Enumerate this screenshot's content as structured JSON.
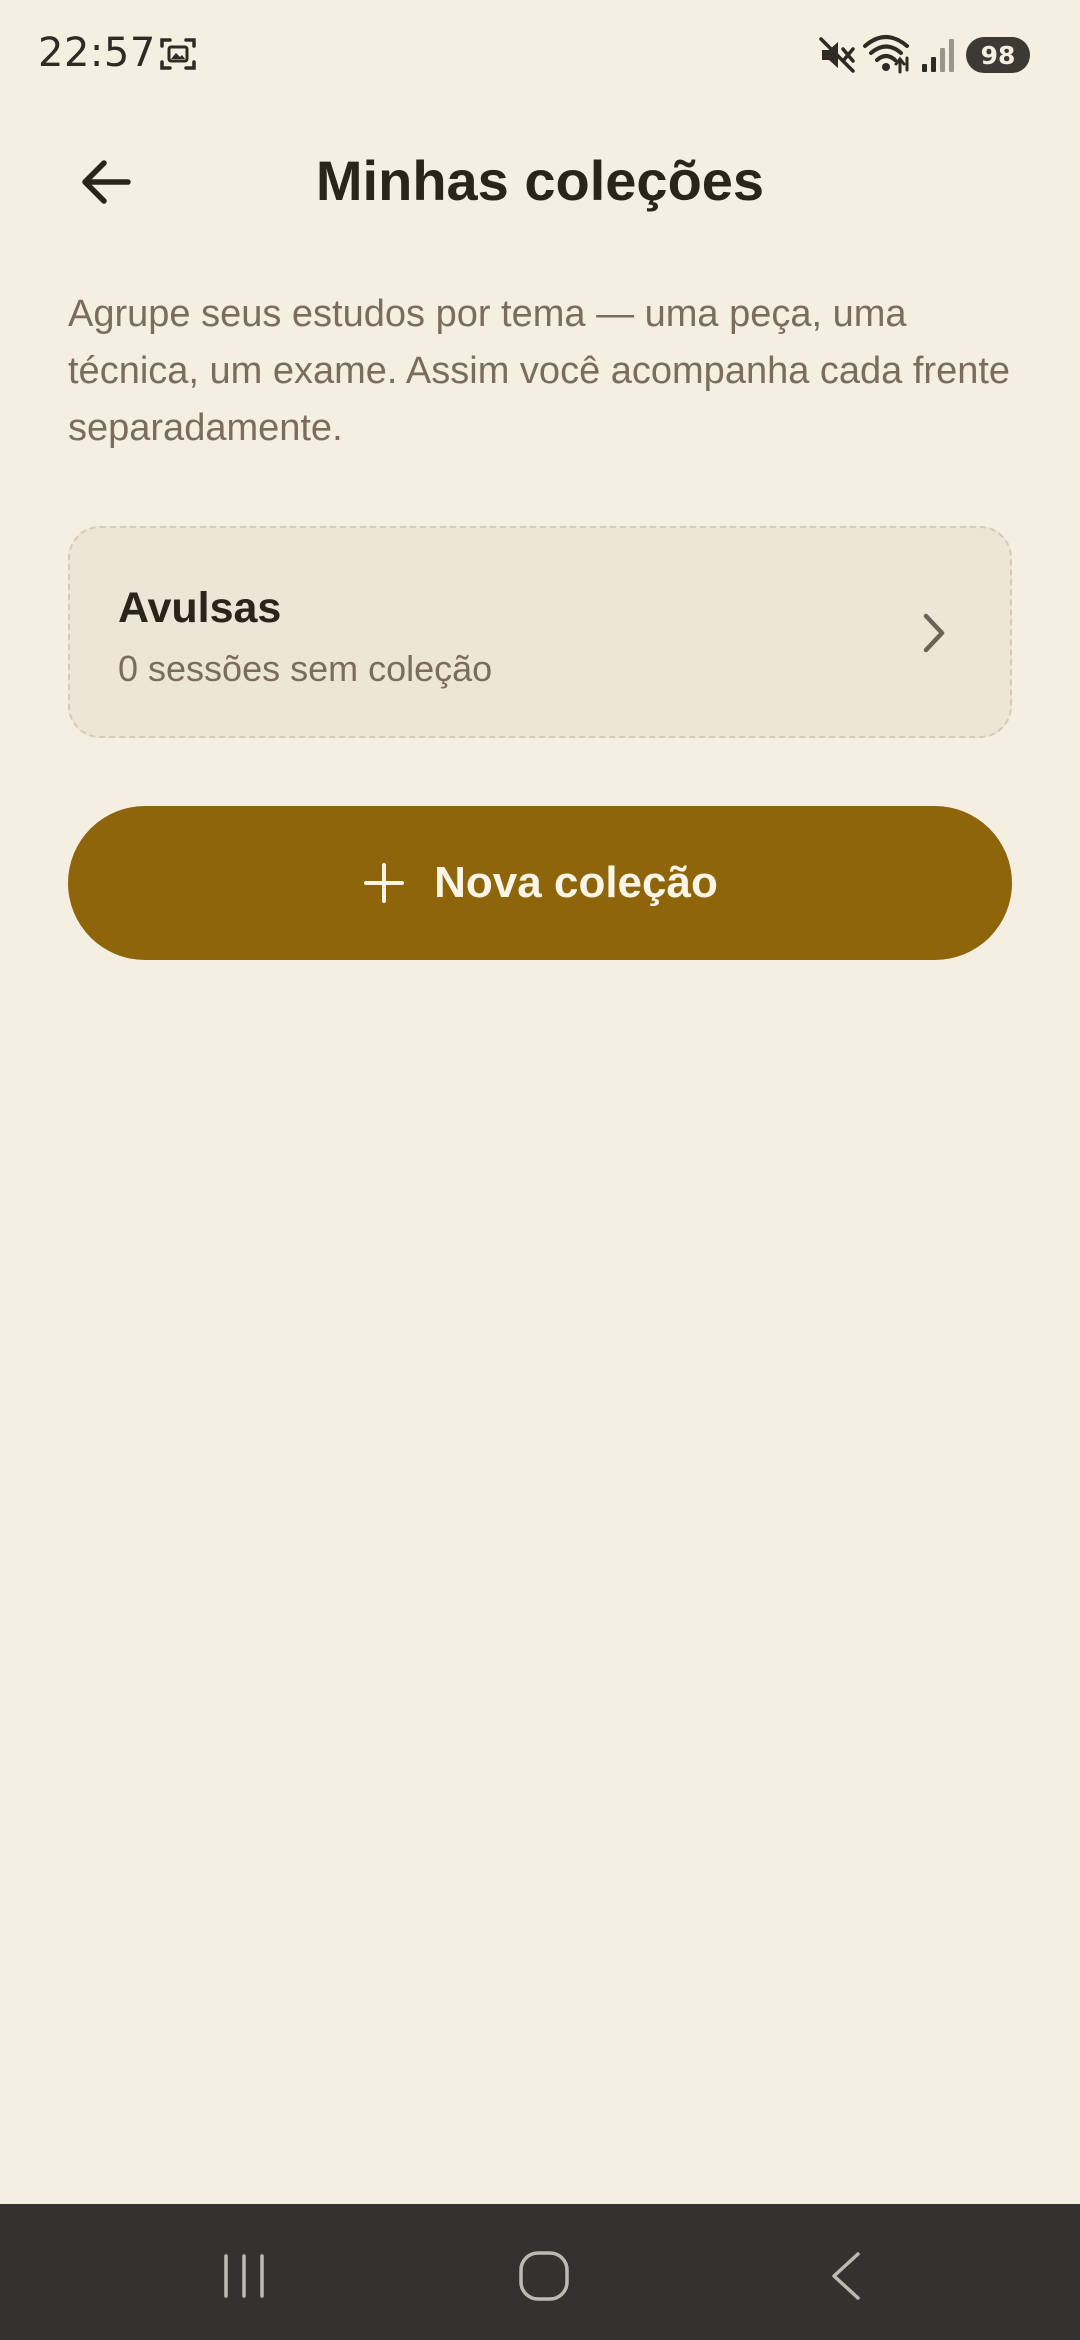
{
  "status_bar": {
    "time": "22:57",
    "battery": "98",
    "icons": [
      "screenshot-icon",
      "mute-icon",
      "wifi-icon",
      "signal-icon"
    ]
  },
  "header": {
    "title": "Minhas coleções",
    "back_icon": "arrow-left-icon"
  },
  "intro": {
    "description": "Agrupe seus estudos por tema — uma peça, uma técnica, um exame. Assim você acompanha cada frente separadamente."
  },
  "collections": [
    {
      "title": "Avulsas",
      "subtitle": "0 sessões sem coleção",
      "icon": "chevron-right-icon"
    }
  ],
  "actions": {
    "new_collection_label": "Nova coleção",
    "new_collection_icon": "plus-icon"
  },
  "nav_bar": {
    "icons": [
      "recents-icon",
      "home-icon",
      "back-icon"
    ]
  },
  "colors": {
    "background": "#f5efe2",
    "card_background": "#ede5d6",
    "accent": "#8e650b",
    "title_text": "#2b2418",
    "secondary_text": "#7a6d5e",
    "nav_bar": "#333230"
  }
}
